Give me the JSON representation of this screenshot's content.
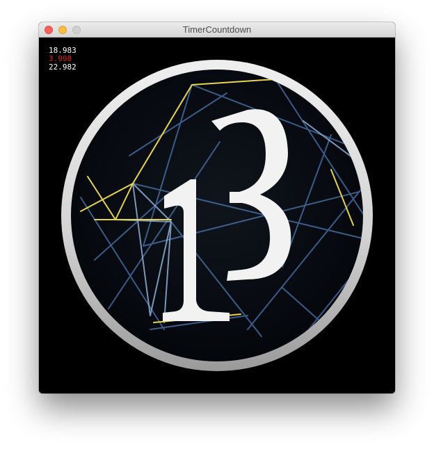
{
  "window": {
    "title": "TimerCountdown"
  },
  "timers": [
    {
      "value": "18.983",
      "color": "#ffffff"
    },
    {
      "value": "3.998",
      "color": "#e31b1b"
    },
    {
      "value": "22.982",
      "color": "#ffffff"
    }
  ],
  "logo": {
    "glyph": "13",
    "ring_color": "#d9d9d9",
    "accent_colors": [
      "#e6d24a",
      "#5a8cc8"
    ]
  },
  "icons": {
    "close": "close-dot-icon",
    "minimize": "minimize-dot-icon",
    "zoom": "zoom-dot-icon"
  }
}
